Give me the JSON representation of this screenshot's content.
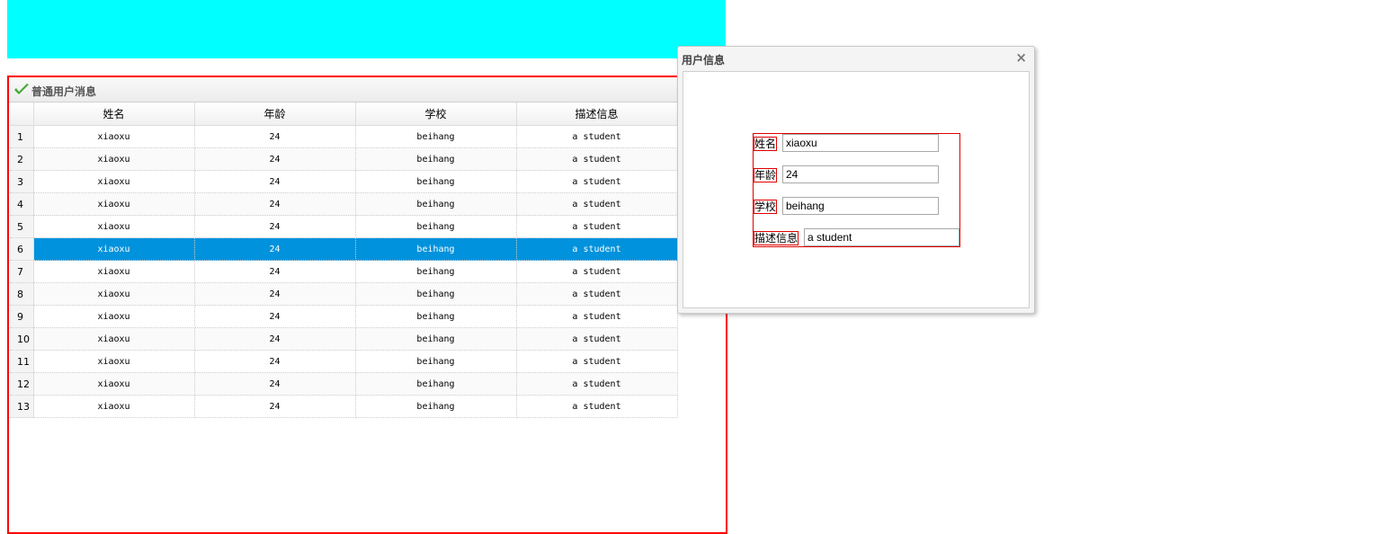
{
  "panel": {
    "title": "普通用户消息",
    "icon": "checkmark-icon",
    "accent": "#44aa33"
  },
  "grid": {
    "columns": [
      "姓名",
      "年龄",
      "学校",
      "描述信息"
    ],
    "rows": [
      {
        "n": "1",
        "name": "xiaoxu",
        "age": "24",
        "school": "beihang",
        "desc": "a student"
      },
      {
        "n": "2",
        "name": "xiaoxu",
        "age": "24",
        "school": "beihang",
        "desc": "a student"
      },
      {
        "n": "3",
        "name": "xiaoxu",
        "age": "24",
        "school": "beihang",
        "desc": "a student"
      },
      {
        "n": "4",
        "name": "xiaoxu",
        "age": "24",
        "school": "beihang",
        "desc": "a student"
      },
      {
        "n": "5",
        "name": "xiaoxu",
        "age": "24",
        "school": "beihang",
        "desc": "a student"
      },
      {
        "n": "6",
        "name": "xiaoxu",
        "age": "24",
        "school": "beihang",
        "desc": "a student"
      },
      {
        "n": "7",
        "name": "xiaoxu",
        "age": "24",
        "school": "beihang",
        "desc": "a student"
      },
      {
        "n": "8",
        "name": "xiaoxu",
        "age": "24",
        "school": "beihang",
        "desc": "a student"
      },
      {
        "n": "9",
        "name": "xiaoxu",
        "age": "24",
        "school": "beihang",
        "desc": "a student"
      },
      {
        "n": "10",
        "name": "xiaoxu",
        "age": "24",
        "school": "beihang",
        "desc": "a student"
      },
      {
        "n": "11",
        "name": "xiaoxu",
        "age": "24",
        "school": "beihang",
        "desc": "a student"
      },
      {
        "n": "12",
        "name": "xiaoxu",
        "age": "24",
        "school": "beihang",
        "desc": "a student"
      },
      {
        "n": "13",
        "name": "xiaoxu",
        "age": "24",
        "school": "beihang",
        "desc": "a student"
      }
    ],
    "selected_row": "6",
    "selected_color": "#0092dc"
  },
  "dialog": {
    "title": "用户信息",
    "close_glyph": "×",
    "close_icon": "close-icon",
    "fields": {
      "name_label": "姓名",
      "name_value": "xiaoxu",
      "age_label": "年龄",
      "age_value": "24",
      "school_label": "学校",
      "school_value": "beihang",
      "desc_label": "描述信息",
      "desc_value": "a student"
    }
  },
  "colors": {
    "banner": "#00ffff",
    "panel_border": "#ff0000"
  }
}
